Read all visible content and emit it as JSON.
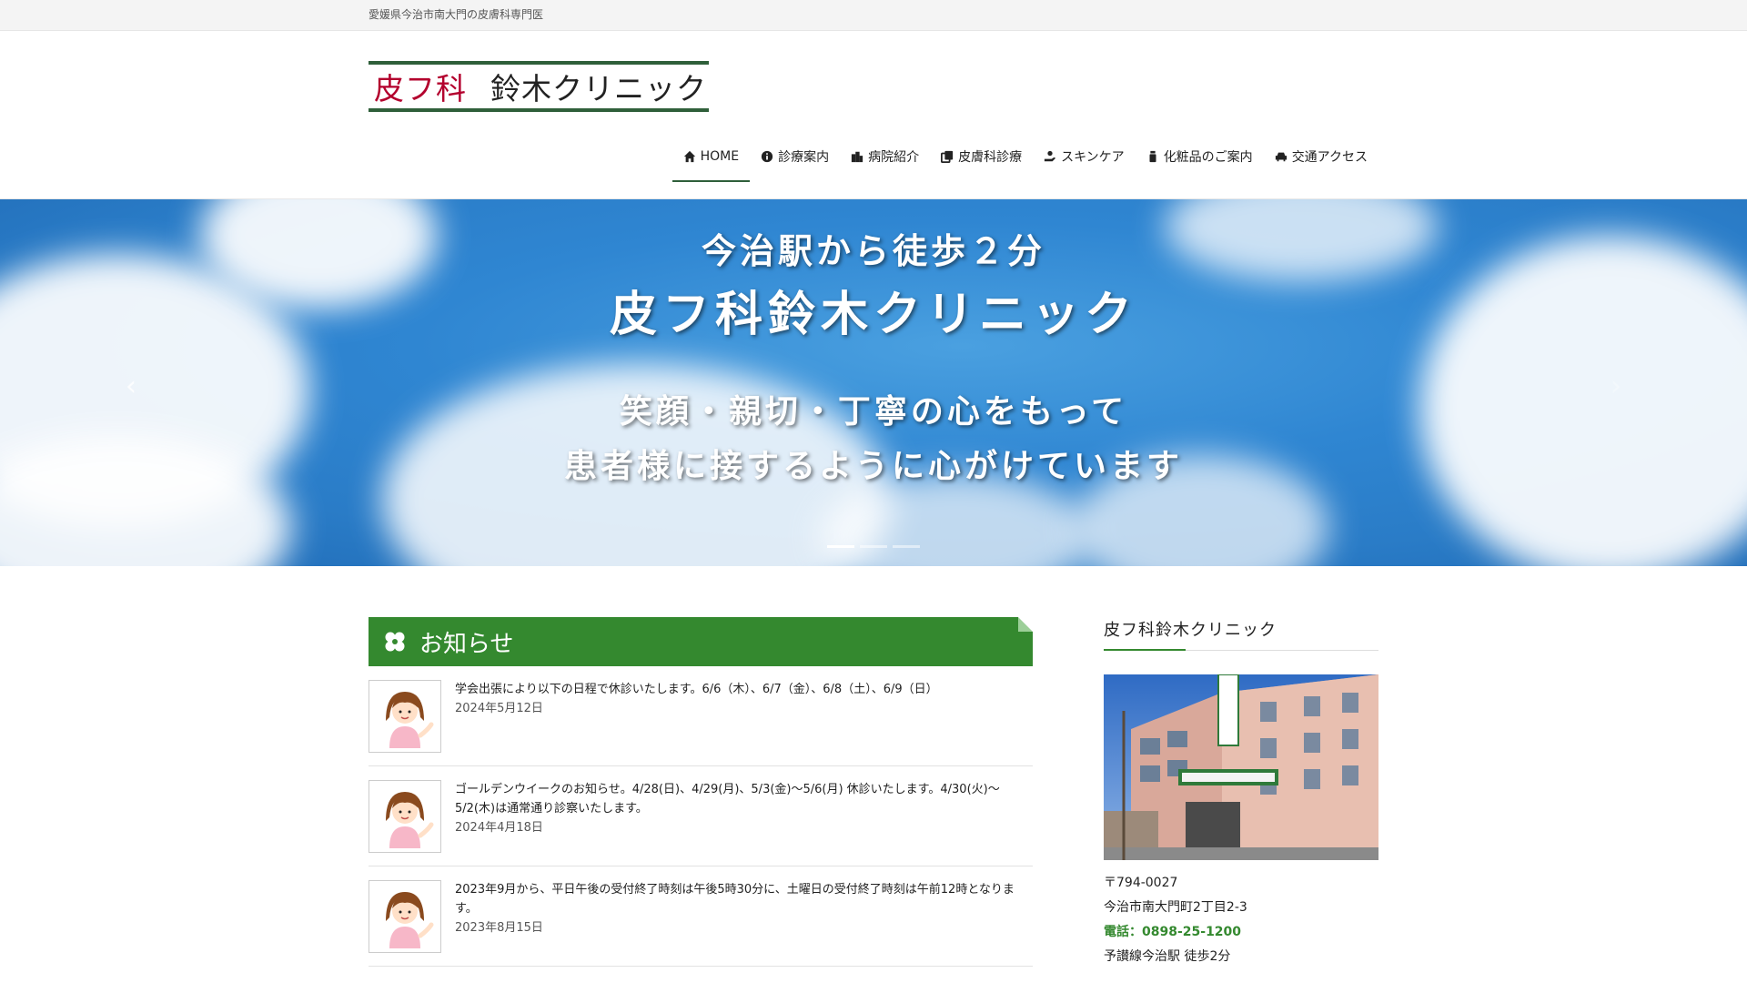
{
  "topbar": {
    "text": "愛媛県今治市南大門の皮膚科専門医"
  },
  "logo": {
    "red": "皮フ科",
    "black": "鈴木クリニック"
  },
  "nav": [
    {
      "label": "HOME",
      "icon": "home-icon"
    },
    {
      "label": "診療案内",
      "icon": "info-icon"
    },
    {
      "label": "病院紹介",
      "icon": "building-icon"
    },
    {
      "label": "皮膚科診療",
      "icon": "copy-icon"
    },
    {
      "label": "スキンケア",
      "icon": "hand-icon"
    },
    {
      "label": "化粧品のご案内",
      "icon": "bottle-icon"
    },
    {
      "label": "交通アクセス",
      "icon": "car-icon"
    }
  ],
  "hero": {
    "line1": "今治駅から徒歩２分",
    "line2": "皮フ科鈴木クリニック",
    "line3": "笑顔・親切・丁寧の心をもって",
    "line4": "患者様に接するように心がけています",
    "prev": "‹",
    "next": "›"
  },
  "news": {
    "title": "お知らせ",
    "items": [
      {
        "text": "学会出張により以下の日程で休診いたします。6/6（木）、6/7（金）、6/8（土）、6/9（日）",
        "date": "2024年5月12日"
      },
      {
        "text": "ゴールデンウイークのお知らせ。4/28(日)、4/29(月)、5/3(金)～5/6(月) 休診いたします。4/30(火)～5/2(木)は通常通り診察いたします。",
        "date": "2024年4月18日"
      },
      {
        "text": "2023年9月から、平日午後の受付終了時刻は午後5時30分に、土曜日の受付終了時刻は午前12時となります。",
        "date": "2023年8月15日"
      }
    ]
  },
  "sidebar": {
    "title": "皮フ科鈴木クリニック",
    "postal": "〒794-0027",
    "address": "今治市南大門町2丁目2-3",
    "tel": "電話：0898-25-1200",
    "access": "予讃線今治駅 徒歩2分"
  },
  "colors": {
    "accent": "#34892f",
    "logo_red": "#b3002d",
    "logo_border": "#2f5f3a"
  }
}
